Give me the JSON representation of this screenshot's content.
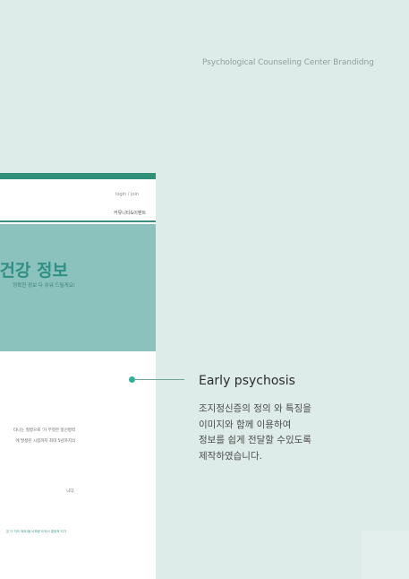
{
  "header": {
    "caption": "Psychological Counseling Center Brandidng"
  },
  "mockup": {
    "login_label": "login / join",
    "nav_item": "커뮤니티&이벤트",
    "hero_title": "건강 정보",
    "hero_subtitle": "정확한 정보 다 쉬워 드릴게요!",
    "body_lines": [
      "타나는 질병으로 '가 뚜렷한 정신병력",
      "에 발생된 시점까지 최대 5년까지의",
      "니다."
    ],
    "footer_link": "은 이 지도 돼요/을 뇌파랑 도와서 결정적 지가"
  },
  "callout": {
    "title": "Early psychosis",
    "description_lines": [
      "조지정신증의 정의 와 특징을",
      "이미지와 함께 이용하여",
      "정보를 쉽게 전달할 수있도록",
      "제작하였습니다."
    ]
  },
  "colors": {
    "background": "#deece9",
    "accent_green": "#2f8f78",
    "hero_teal": "#8bc2be",
    "hero_text": "#2f8f84",
    "dot": "#2eb39a"
  }
}
